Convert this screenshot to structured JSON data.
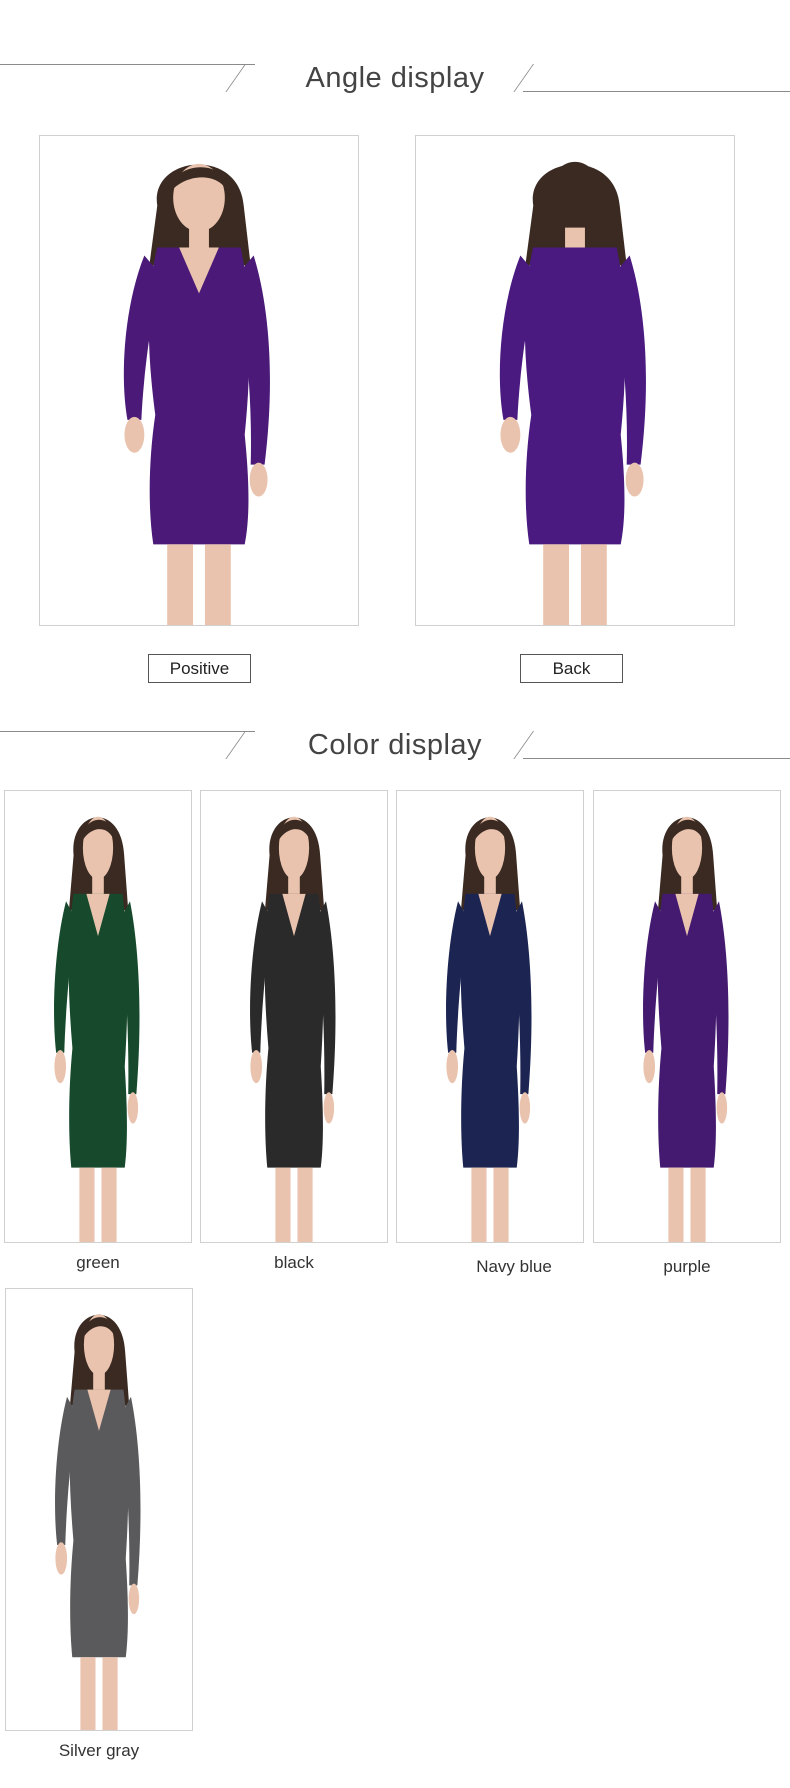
{
  "angle_section": {
    "title": "Angle display",
    "views": [
      {
        "label": "Positive",
        "dress_color": "#4b1a78",
        "orientation": "front"
      },
      {
        "label": "Back",
        "dress_color": "#4a1a80",
        "orientation": "back"
      }
    ]
  },
  "color_section": {
    "title": "Color display",
    "variants": [
      {
        "label": "green",
        "dress_color": "#174a2c"
      },
      {
        "label": "black",
        "dress_color": "#2a2a2a"
      },
      {
        "label": "Navy blue",
        "dress_color": "#1c2552"
      },
      {
        "label": "purple",
        "dress_color": "#441a70"
      },
      {
        "label": "Silver gray",
        "dress_color": "#5a5a5c"
      }
    ]
  },
  "colors": {
    "skin": "#e9c3ae",
    "hair": "#3a2a22",
    "frame_border": "#d0d0d0",
    "rule": "#8a8a8a"
  }
}
